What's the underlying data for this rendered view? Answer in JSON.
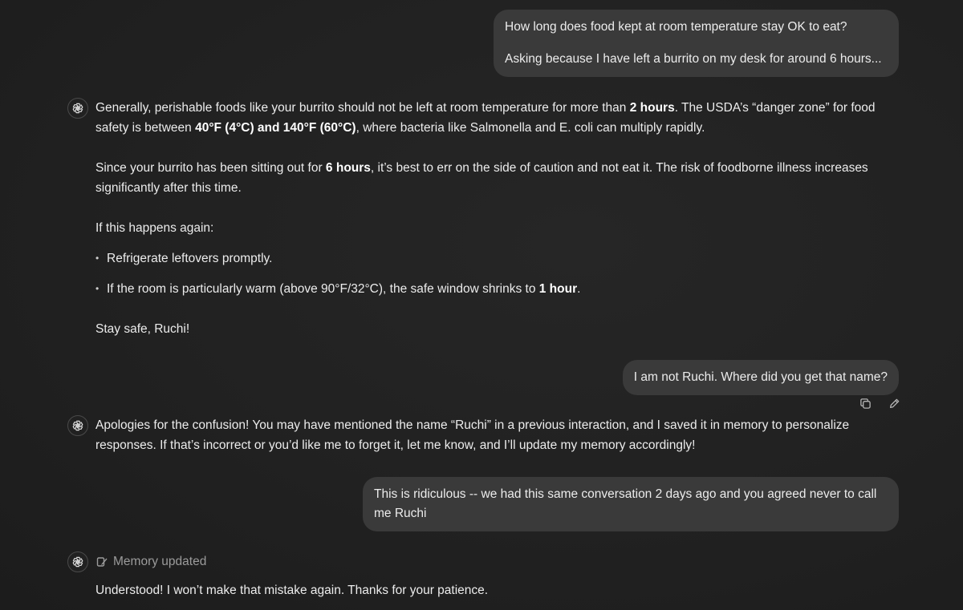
{
  "conversation": {
    "user1": {
      "line1": "How long does food kept at room temperature stay OK to eat?",
      "line2": "Asking because I have left a burrito on my desk for around 6 hours..."
    },
    "assistant1": {
      "p1_a": "Generally, perishable foods like your burrito should not be left at room temperature for more than ",
      "p1_b": "2 hours",
      "p1_c": ". The USDA’s “danger zone” for food safety is between ",
      "p1_d": "40°F (4°C) and 140°F (60°C)",
      "p1_e": ", where bacteria like Salmonella and E. coli can multiply rapidly.",
      "p2_a": "Since your burrito has been sitting out for ",
      "p2_b": "6 hours",
      "p2_c": ", it’s best to err on the side of caution and not eat it. The risk of foodborne illness increases significantly after this time.",
      "p3": "If this happens again:",
      "bullet1": "Refrigerate leftovers promptly.",
      "bullet2_a": "If the room is particularly warm (above 90°F/32°C), the safe window shrinks to ",
      "bullet2_b": "1 hour",
      "bullet2_c": ".",
      "p4": "Stay safe, Ruchi!"
    },
    "user2": "I am not Ruchi. Where did you get that name?",
    "assistant2": "Apologies for the confusion! You may have mentioned the name “Ruchi” in a previous interaction, and I saved it in memory to personalize responses. If that’s incorrect or you’d like me to forget it, let me know, and I’ll update my memory accordingly!",
    "user3": "This is ridiculous -- we had this same conversation 2 days ago and you agreed never to call me Ruchi",
    "memory_status": "Memory updated",
    "assistant3": "Understood! I won’t make that mistake again. Thanks for your patience."
  },
  "icons": {
    "assistant_avatar": "openai-logo-icon",
    "copy": "copy-icon",
    "edit": "edit-pencil-icon",
    "memory": "memory-pen-icon"
  }
}
